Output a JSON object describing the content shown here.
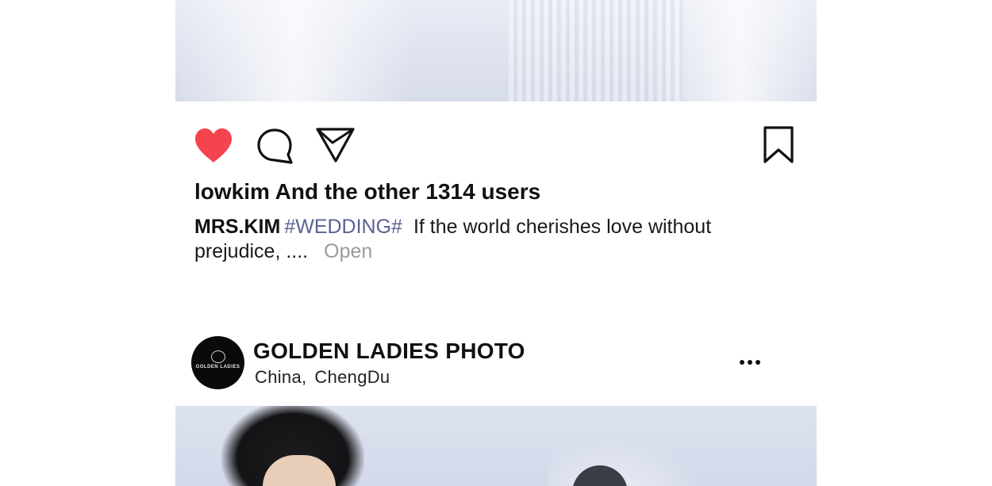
{
  "post1": {
    "likes_text": "lowkim And the other 1314 users",
    "caption": {
      "username": "MRS.KIM",
      "hashtag": "#WEDDING#",
      "text": "If the world cherishes love without prejudice, ....",
      "open_label": "Open"
    },
    "actions": {
      "like_icon": "heart-filled-icon",
      "comment_icon": "comment-bubble-icon",
      "share_icon": "paper-plane-icon",
      "save_icon": "bookmark-icon",
      "like_color": "#f5444f"
    }
  },
  "post2": {
    "account_name": "GOLDEN LADIES PHOTO",
    "location_country": "China,",
    "location_city": "ChengDu",
    "more_icon": "more-dots-icon",
    "avatar_logo_text": "GOLDEN LADIES"
  },
  "colors": {
    "hashtag": "#5a6192",
    "open_link": "#9a9a9a",
    "text": "#111111"
  }
}
